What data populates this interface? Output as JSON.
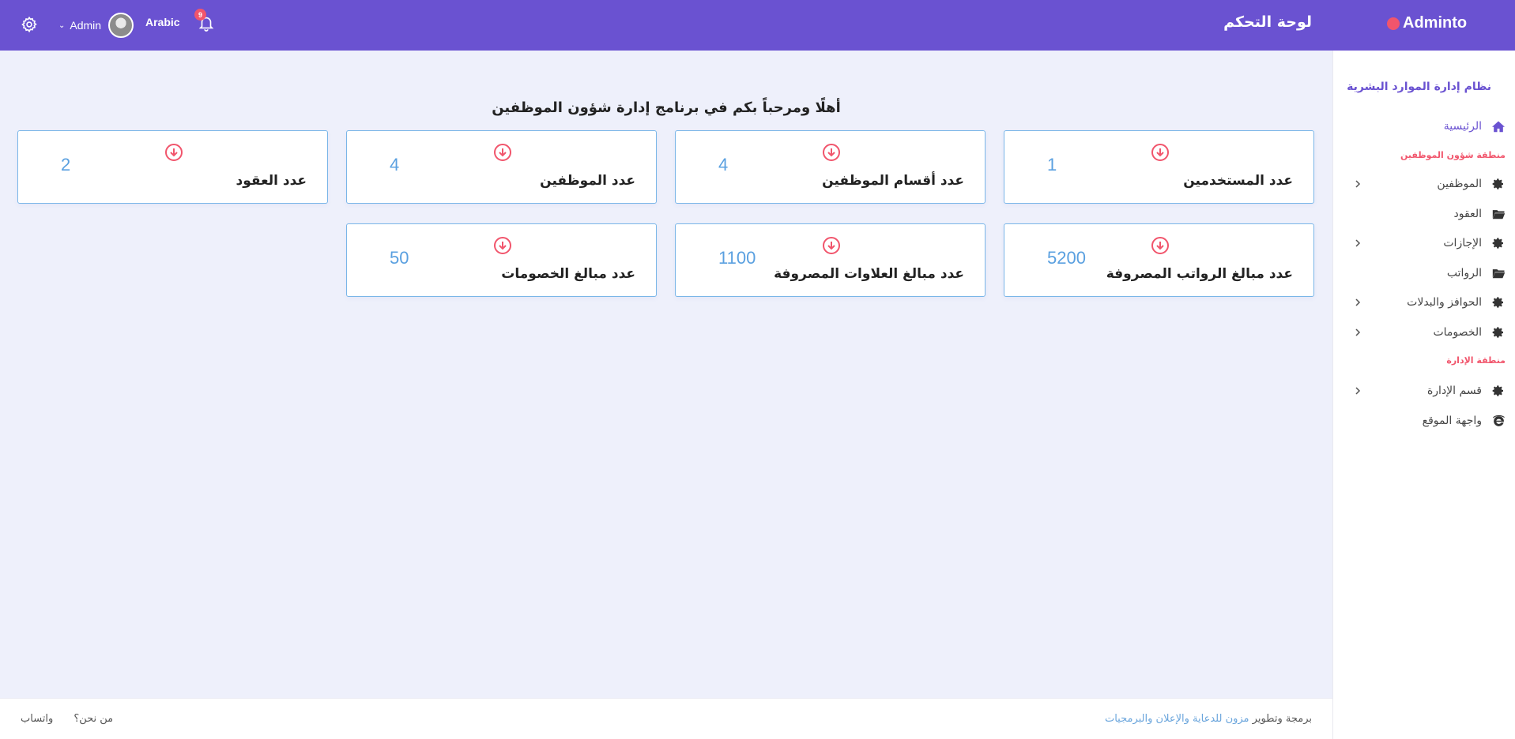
{
  "header": {
    "brand": "Adminto",
    "page_title": "لوحة التحكم",
    "language": "Arabic",
    "user_name": "Admin",
    "notification_count": "9",
    "colors": {
      "bar": "#6a52d1",
      "badge": "#f1556c"
    }
  },
  "sidebar": {
    "title": "نظام إدارة الموارد البشرية",
    "home": "الرئيسية",
    "section_employees": "منطقة شؤون الموظفين",
    "items": [
      {
        "label": "الموظفين",
        "icon": "gear-icon",
        "has_submenu": true
      },
      {
        "label": "العقود",
        "icon": "folder-icon",
        "has_submenu": false
      },
      {
        "label": "الإجازات",
        "icon": "gear-icon",
        "has_submenu": true
      },
      {
        "label": "الرواتب",
        "icon": "folder-icon",
        "has_submenu": false
      },
      {
        "label": "الحوافز والبدلات",
        "icon": "gear-icon",
        "has_submenu": true
      },
      {
        "label": "الخصومات",
        "icon": "gear-icon",
        "has_submenu": true
      }
    ],
    "section_admin": "منطقة الإدارة",
    "admin_items": [
      {
        "label": "قسم الإدارة",
        "icon": "gear-icon",
        "has_submenu": true
      },
      {
        "label": "واجهة الموقع",
        "icon": "browser-icon",
        "has_submenu": false
      }
    ]
  },
  "main": {
    "welcome": "أهلًا ومرحباً بكم في برنامج إدارة شؤون الموظفين",
    "cards": [
      {
        "label": "عدد المستخدمين",
        "value": "1"
      },
      {
        "label": "عدد أقسام الموظفين",
        "value": "4"
      },
      {
        "label": "عدد الموظفين",
        "value": "4"
      },
      {
        "label": "عدد العقود",
        "value": "2"
      },
      {
        "label": "عدد مبالغ الرواتب المصروفة",
        "value": "5200"
      },
      {
        "label": "عدد مبالغ العلاوات المصروفة",
        "value": "1100"
      },
      {
        "label": "عدد مبالغ الخصومات",
        "value": "50"
      }
    ]
  },
  "footer": {
    "whatsapp": "واتساب",
    "about": "من نحن؟",
    "credit_prefix": "برمجة وتطوير",
    "credit_link": "مزون للدعاية والإعلان والبرمجيات"
  }
}
